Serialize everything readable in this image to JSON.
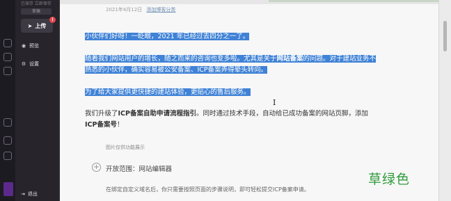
{
  "sidebar": {
    "top_line": "已保存 立即保存",
    "tag": "草稿",
    "publish": {
      "label": "上传",
      "badge": "!"
    },
    "items": [
      {
        "label": "预览",
        "icon": "eye-icon"
      },
      {
        "label": "设置",
        "icon": "gear-icon"
      }
    ],
    "logout": {
      "label": "退出",
      "icon": "logout-icon"
    }
  },
  "document": {
    "meta_date": "2021年4月12日",
    "meta_link": "添加博客分类",
    "paragraphs": {
      "p1": "小伙伴们好呀！一眨眼，2021 年已经过去四分之一了。",
      "p2a": "随着我们网站用户的增长，随之而来的咨询也变多啦。尤其是关于",
      "p2b": "网站备案",
      "p2c": "的问题。对于建站业务不",
      "p2d": "熟悉的小伙伴，确实容易被公安备案、ICP备案弄得晕头转向。",
      "p3": "为了给大家提供更快捷的建站体验，更贴心的售后服务。",
      "p4a": "我们升级了",
      "p4b": "ICP备案自助申请流程指引",
      "p4c": "。同时通过技术手段，自动给已成功备案的网站页脚，添加",
      "p4d": "ICP备案号",
      "p4e": "！"
    },
    "caption": "图片仅供功能展示",
    "subheading": "开放范围：网站编辑器",
    "p5": "在绑定自定义域名后，你只需要按照页面的步骤说明，即可轻松提交ICP备案申请。",
    "overlay_note": "草绿色"
  },
  "colors": {
    "selection": "#3f82d6",
    "overlay_text": "#2e9b3a",
    "sidebar_bg": "#27252b"
  }
}
